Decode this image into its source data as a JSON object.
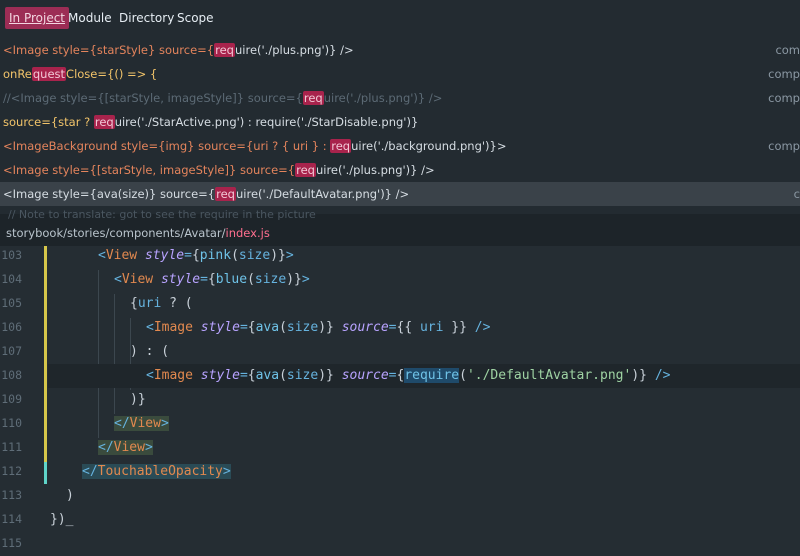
{
  "tabs": [
    {
      "label": "In Project",
      "active": true
    },
    {
      "label": "Module",
      "active": false
    },
    {
      "label": "Directory",
      "active": false
    },
    {
      "label": "Scope",
      "active": false
    }
  ],
  "results": [
    {
      "pre": "<Image style={starStyle} source={",
      "hl": "req",
      "post": "uire('./plus.png')} />",
      "where": "com"
    },
    {
      "pre": "onRe",
      "hl": "quest",
      "post": "Close={() => {",
      "where": "comp"
    },
    {
      "pre": "//<Image style={[starStyle, imageStyle]} source={",
      "hl": "req",
      "post": "uire('./plus.png')} />",
      "where": "comp"
    },
    {
      "pre": "source={star ? ",
      "hl": "req",
      "post": "uire('./StarActive.png') : require('./StarDisable.png')}",
      "where": ""
    },
    {
      "pre": "<ImageBackground style={img} source={uri ? { uri } : ",
      "hl": "req",
      "post": "uire('./background.png')}>",
      "where": "comp"
    },
    {
      "pre": "<Image style={[starStyle, imageStyle]} source={",
      "hl": "req",
      "post": "uire('./plus.png')} />",
      "where": ""
    },
    {
      "pre": "<Image style={ava(size)} source={",
      "hl": "req",
      "post": "uire('./DefaultAvatar.png')} />",
      "where": "c"
    }
  ],
  "ghost_row": "// Note to translate: got to see the require in the picture",
  "path": {
    "dir": "storybook/stories/components/Avatar/",
    "file": "index.js"
  },
  "editor": {
    "line_numbers": [
      "103",
      "104",
      "105",
      "106",
      "107",
      "108",
      "109",
      "110",
      "111",
      "112",
      "113",
      "114",
      "115"
    ],
    "lines": [
      "<View style={pink(size)}>",
      "<View style={blue(size)}>",
      "{uri ? (",
      "<Image style={ava(size)} source={{ uri }} />",
      ") : (",
      "<Image style={ava(size)} source={require('./DefaultAvatar.png')} />",
      ")}",
      "</View>",
      "</View>",
      "</TouchableOpacity>",
      ")",
      "})",
      ""
    ]
  },
  "colors": {
    "accent": "#9c2d55",
    "highlight": "#a8234c",
    "background": "#232b31"
  }
}
